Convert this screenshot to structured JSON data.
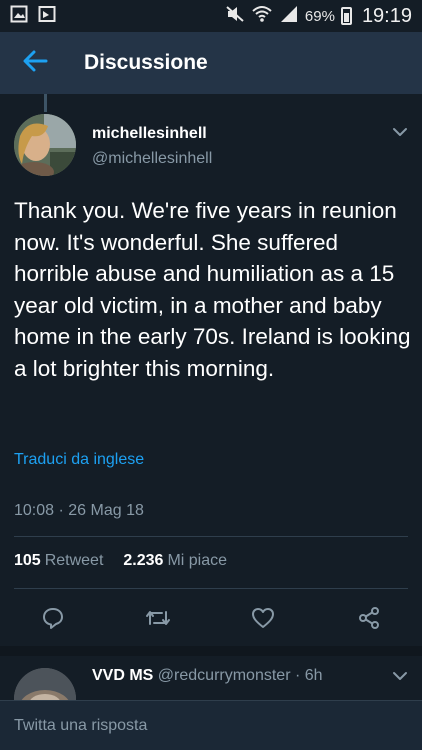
{
  "status_bar": {
    "battery": "69%",
    "time": "19:19",
    "icons": [
      "gallery-icon",
      "flag-icon",
      "mute-icon",
      "wifi-icon",
      "signal-icon",
      "battery-icon"
    ]
  },
  "header": {
    "title": "Discussione",
    "back_icon": "arrow-left-icon"
  },
  "tweet": {
    "author_name": "michellesinhell",
    "author_handle": "@michellesinhell",
    "text": "Thank you. We're five years in reunion now. It's wonderful. She suffered horrible abuse and humiliation as a 15 year old victim, in a mother and baby home in the early 70s. Ireland is looking a lot brighter this morning.",
    "translate_label": "Traduci da inglese",
    "timestamp": "10:08 · 26 Mag 18",
    "retweet_count": "105",
    "retweet_label": "Retweet",
    "like_count": "2.236",
    "like_label": "Mi piace",
    "actions": [
      "reply-icon",
      "retweet-icon",
      "heart-icon",
      "share-icon"
    ]
  },
  "reply": {
    "name": "VVD MS",
    "handle_time": "@redcurrymonster · 6h"
  },
  "compose": {
    "placeholder": "Twitta una risposta"
  },
  "colors": {
    "background": "#141d26",
    "header": "#243447",
    "accent": "#1da1f2",
    "secondary_text": "#8899a6"
  }
}
